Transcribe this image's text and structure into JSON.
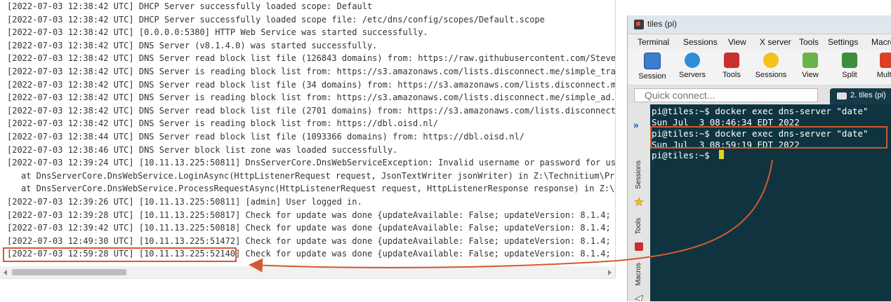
{
  "log": {
    "lines": [
      "[2022-07-03 12:38:42 UTC] DHCP Server successfully loaded scope: Default",
      "[2022-07-03 12:38:42 UTC] DHCP Server successfully loaded scope file: /etc/dns/config/scopes/Default.scope",
      "[2022-07-03 12:38:42 UTC] [0.0.0.0:5380] HTTP Web Service was started successfully.",
      "[2022-07-03 12:38:42 UTC] DNS Server (v8.1.4.0) was started successfully.",
      "[2022-07-03 12:38:42 UTC] DNS Server read block list file (126843 domains) from: https://raw.githubusercontent.com/Steven",
      "[2022-07-03 12:38:42 UTC] DNS Server is reading block list from: https://s3.amazonaws.com/lists.disconnect.me/simple_trac",
      "[2022-07-03 12:38:42 UTC] DNS Server read block list file (34 domains) from: https://s3.amazonaws.com/lists.disconnect.me",
      "[2022-07-03 12:38:42 UTC] DNS Server is reading block list from: https://s3.amazonaws.com/lists.disconnect.me/simple_ad.t",
      "[2022-07-03 12:38:42 UTC] DNS Server read block list file (2701 domains) from: https://s3.amazonaws.com/lists.disconnect.",
      "[2022-07-03 12:38:42 UTC] DNS Server is reading block list from: https://dbl.oisd.nl/",
      "[2022-07-03 12:38:44 UTC] DNS Server read block list file (1093366 domains) from: https://dbl.oisd.nl/",
      "[2022-07-03 12:38:46 UTC] DNS Server block list zone was loaded successfully.",
      "[2022-07-03 12:39:24 UTC] [10.11.13.225:50811] DnsServerCore.DnsWebServiceException: Invalid username or password for use",
      "at DnsServerCore.DnsWebService.LoginAsync(HttpListenerRequest request, JsonTextWriter jsonWriter) in Z:\\Technitium\\Pro",
      "at DnsServerCore.DnsWebService.ProcessRequestAsync(HttpListenerRequest request, HttpListenerResponse response) in Z:\\T",
      "[2022-07-03 12:39:26 UTC] [10.11.13.225:50811] [admin] User logged in.",
      "[2022-07-03 12:39:28 UTC] [10.11.13.225:50817] Check for update was done {updateAvailable: False; updateVersion: 8.1.4; u",
      "[2022-07-03 12:39:42 UTC] [10.11.13.225:50818] Check for update was done {updateAvailable: False; updateVersion: 8.1.4; u",
      "[2022-07-03 12:49:30 UTC] [10.11.13.225:51472] Check for update was done {updateAvailable: False; updateVersion: 8.1.4; u",
      "[2022-07-03 12:59:28 UTC] [10.11.13.225:52140] Check for update was done {updateAvailable: False; updateVersion: 8.1.4; u"
    ]
  },
  "window": {
    "title": "tiles (pi)"
  },
  "menu": [
    "Terminal",
    "Sessions",
    "View",
    "X server",
    "Tools",
    "Settings",
    "Macro"
  ],
  "toolbar": [
    "Session",
    "Servers",
    "Tools",
    "Sessions",
    "View",
    "Split",
    "MultiE"
  ],
  "quick_connect": {
    "placeholder": "Quick connect..."
  },
  "session_tab": {
    "label": "2. tiles (pi)"
  },
  "side_tabs": [
    "Sessions",
    "Tools",
    "Macros"
  ],
  "terminal": {
    "lines": [
      "pi@tiles:~$ docker exec dns-server \"date\"",
      "Sun Jul  3 08:46:34 EDT 2022",
      "pi@tiles:~$ docker exec dns-server \"date\"",
      "Sun Jul  3 08:59:19 EDT 2022",
      "pi@tiles:~$ "
    ]
  },
  "colors": {
    "highlight": "#d35a2e",
    "terminal_bg": "#0f3440",
    "cursor": "#e6d21a",
    "session_tab": "#163a4a"
  }
}
